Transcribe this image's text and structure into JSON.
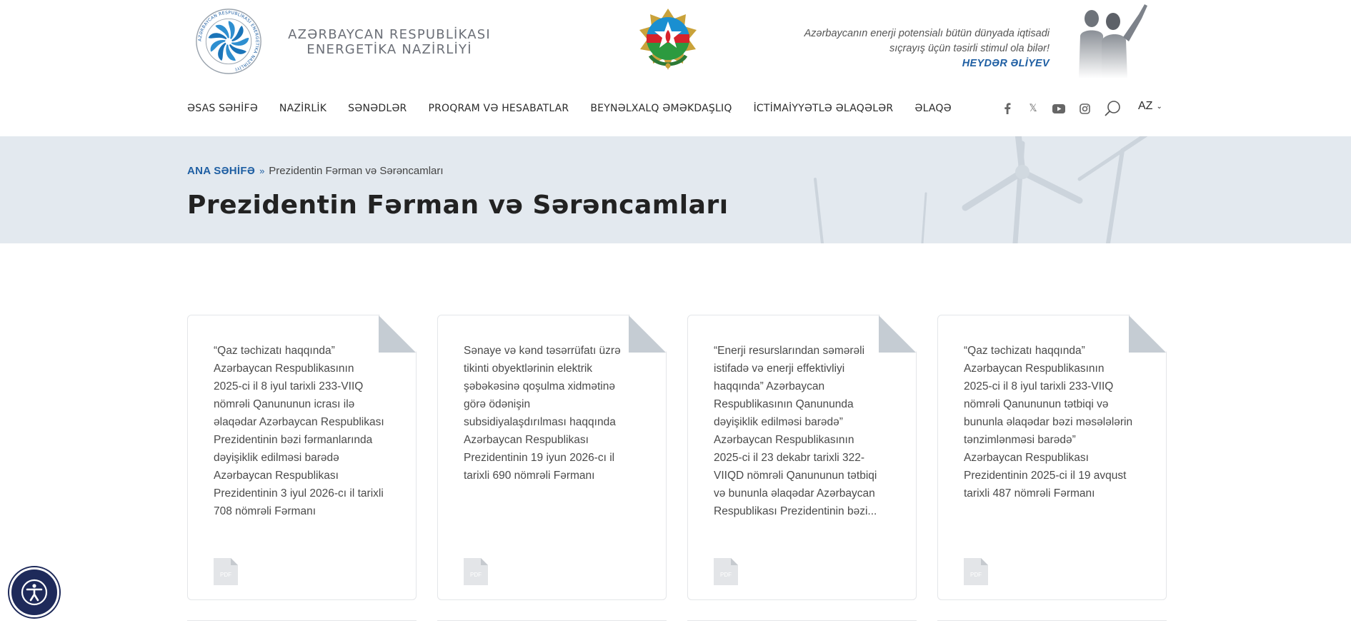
{
  "header": {
    "logo": {
      "ring_text": "AZƏRBAYCAN RESPUBLİKASI ENERGETİKA NAZİRLİYİ",
      "line1": "AZƏRBAYCAN RESPUBLİKASI",
      "line2": "ENERGETİKA NAZİRLİYİ"
    },
    "quote": {
      "line1": "Azərbaycanın enerji potensialı bütün dünyada iqtisadi",
      "line2": "sıçrayış üçün təsirli stimul ola bilər!",
      "author": "HEYDƏR ƏLİYEV"
    }
  },
  "nav": {
    "items": [
      "ƏSAS SƏHİFƏ",
      "NAZİRLİK",
      "SƏNƏDLƏR",
      "PROQRAM VƏ HESABATLAR",
      "BEYNƏLXALQ ƏMƏKDAŞLIQ",
      "İCTİMAİYYƏTLƏ ƏLAQƏLƏR",
      "ƏLAQƏ"
    ],
    "social_icons": [
      "facebook-icon",
      "x-icon",
      "youtube-icon",
      "instagram-icon"
    ],
    "x_glyph": "𝕏",
    "language": "AZ",
    "lang_chevron": "⌄"
  },
  "breadcrumb": {
    "home": "ANA SƏHİFƏ",
    "separator": "»",
    "current": "Prezidentin Fərman və Sərəncamları"
  },
  "page_title": "Prezidentin Fərman və Sərəncamları",
  "cards": [
    {
      "text": "“Qaz təchizatı haqqında” Azərbaycan Respublikasının 2025-ci il 8 iyul tarixli 233-VIIQ nömrəli Qanununun icrası ilə əlaqədar Azərbaycan Respublikası Prezidentinin bəzi fərmanlarında dəyişiklik edilməsi barədə Azərbaycan Respublikası Prezidentinin 3 iyul 2026-cı il tarixli 708 nömrəli Fərmanı",
      "pdf_label": "PDF"
    },
    {
      "text": "Sənaye və kənd təsərrüfatı üzrə tikinti obyektlərinin elektrik şəbəkəsinə qoşulma xidmətinə görə ödənişin subsidiyalaşdırılması haqqında Azərbaycan Respublikası Prezidentinin 19 iyun 2026-cı il tarixli 690 nömrəli Fərmanı",
      "pdf_label": "PDF"
    },
    {
      "text": "“Enerji resurslarından səmərəli istifadə və enerji effektivliyi haqqında” Azərbaycan Respublikasının Qanununda dəyişiklik edilməsi barədə” Azərbaycan Respublikasının 2025-ci il 23 dekabr tarixli 322-VIIQD nömrəli Qanununun tətbiqi və bununla əlaqədar Azərbaycan Respublikası Prezidentinin bəzi...",
      "pdf_label": "PDF"
    },
    {
      "text": "“Qaz təchizatı haqqında” Azərbaycan Respublikasının 2025-ci il 8 iyul tarixli 233-VIIQ nömrəli Qanununun tətbiqi və bununla əlaqədar bəzi məsələlərin tənzimlənməsi barədə” Azərbaycan Respublikası Prezidentinin 2025-ci il 19 avqust tarixli 487 nömrəli Fərmanı",
      "pdf_label": "PDF"
    }
  ],
  "colors": {
    "accent": "#1f5fa3",
    "banner_bg": "#e3e9ef",
    "a11y_bg": "#1e2a5a"
  }
}
